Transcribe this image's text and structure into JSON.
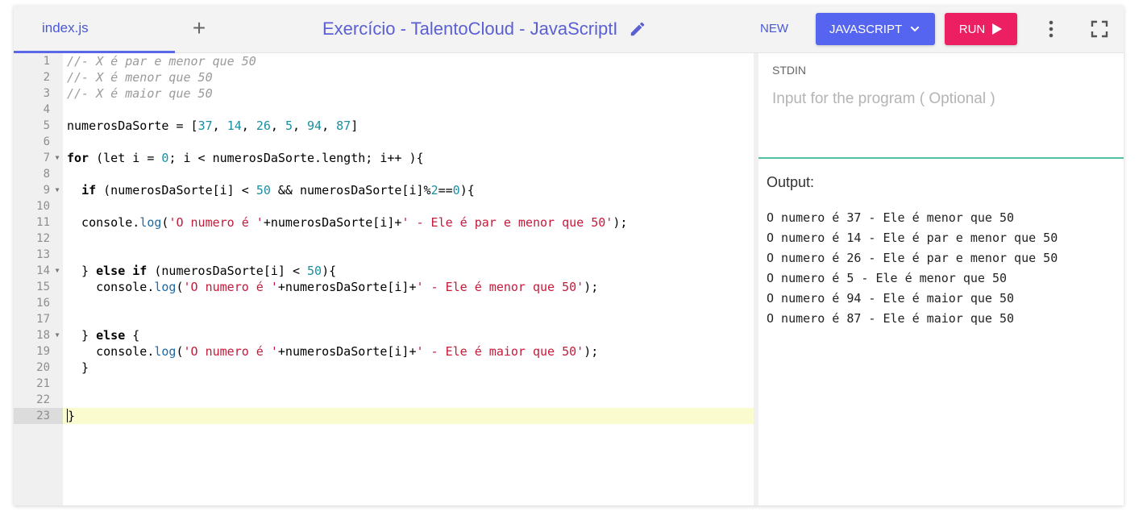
{
  "toolbar": {
    "file_tab": "index.js",
    "add_tab_icon": "plus-icon",
    "title": "Exercício - TalentoCloud - JavaScriptI",
    "edit_icon": "pencil-icon",
    "new_label": "NEW",
    "language_label": "JAVASCRIPT",
    "run_label": "RUN",
    "colors": {
      "language_button": "#5565f0",
      "run_button": "#ec1f63",
      "accent": "#4a58d6"
    }
  },
  "editor": {
    "active_line": 23,
    "lines": [
      {
        "n": "1",
        "html": "<span class=\"c-comment\">//- X é par e menor que 50</span>"
      },
      {
        "n": "2",
        "html": "<span class=\"c-comment\">//- X é menor que 50</span>"
      },
      {
        "n": "3",
        "html": "<span class=\"c-comment\">//- X é maior que 50</span>"
      },
      {
        "n": "4",
        "html": ""
      },
      {
        "n": "5",
        "html": "numerosDaSorte = [<span class=\"c-num\">37</span>, <span class=\"c-num\">14</span>, <span class=\"c-num\">26</span>, <span class=\"c-num\">5</span>, <span class=\"c-num\">94</span>, <span class=\"c-num\">87</span>]"
      },
      {
        "n": "6",
        "html": ""
      },
      {
        "n": "7",
        "fold": true,
        "html": "<span class=\"c-kw\">for</span> (let i = <span class=\"c-num\">0</span>; i &lt; numerosDaSorte.length; i++ ){"
      },
      {
        "n": "8",
        "html": ""
      },
      {
        "n": "9",
        "fold": true,
        "html": "  <span class=\"c-kw\">if</span> (numerosDaSorte[i] &lt; <span class=\"c-num\">50</span> &amp;&amp; numerosDaSorte[i]%<span class=\"c-num\">2</span>==<span class=\"c-num\">0</span>){"
      },
      {
        "n": "10",
        "html": ""
      },
      {
        "n": "11",
        "html": "  console.<span class=\"c-prop\">log</span>(<span class=\"c-str\">'O numero é '</span>+numerosDaSorte[i]+<span class=\"c-str\">' - Ele é par e menor que 50'</span>);"
      },
      {
        "n": "12",
        "html": ""
      },
      {
        "n": "13",
        "html": ""
      },
      {
        "n": "14",
        "fold": true,
        "html": "  } <span class=\"c-kw\">else if</span> (numerosDaSorte[i] &lt; <span class=\"c-num\">50</span>){"
      },
      {
        "n": "15",
        "html": "    console.<span class=\"c-prop\">log</span>(<span class=\"c-str\">'O numero é '</span>+numerosDaSorte[i]+<span class=\"c-str\">' - Ele é menor que 50'</span>);"
      },
      {
        "n": "16",
        "html": ""
      },
      {
        "n": "17",
        "html": ""
      },
      {
        "n": "18",
        "fold": true,
        "html": "  } <span class=\"c-kw\">else</span> {"
      },
      {
        "n": "19",
        "html": "    console.<span class=\"c-prop\">log</span>(<span class=\"c-str\">'O numero é '</span>+numerosDaSorte[i]+<span class=\"c-str\">' - Ele é maior que 50'</span>);"
      },
      {
        "n": "20",
        "html": "  }"
      },
      {
        "n": "21",
        "html": ""
      },
      {
        "n": "22",
        "html": ""
      },
      {
        "n": "23",
        "html": "<span class=\"cursor\"></span>}"
      }
    ]
  },
  "stdin": {
    "label": "STDIN",
    "placeholder": "Input for the program ( Optional )"
  },
  "output": {
    "label": "Output:",
    "lines": [
      "O numero é 37 - Ele é menor que 50",
      "O numero é 14 - Ele é par e menor que 50",
      "O numero é 26 - Ele é par e menor que 50",
      "O numero é 5 - Ele é menor que 50",
      "O numero é 94 - Ele é maior que 50",
      "O numero é 87 - Ele é maior que 50"
    ]
  }
}
